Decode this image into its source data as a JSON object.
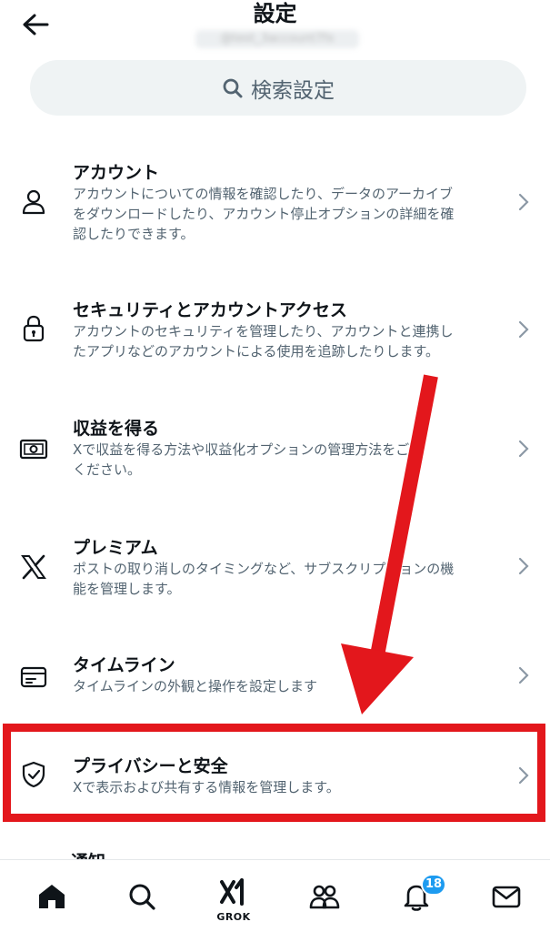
{
  "header": {
    "title": "設定",
    "account_handle": "@test_3account7fx"
  },
  "search": {
    "label": "検索設定"
  },
  "settings": [
    {
      "icon": "person-icon",
      "title": "アカウント",
      "desc": [
        "アカウントについての情報を確認したり、データのアーカイブ",
        "をダウンロードしたり、アカウント停止オプションの詳細を確",
        "認したりできます。"
      ]
    },
    {
      "icon": "lock-icon",
      "title": "セキュリティとアカウントアクセス",
      "desc": [
        "アカウントのセキュリティを管理したり、アカウントと連携し",
        "たアプリなどのアカウントによる使用を追跡したりします。"
      ]
    },
    {
      "icon": "money-icon",
      "title": "収益を得る",
      "desc": [
        "Xで収益を得る方法や収益化オプションの管理方法をご覧",
        "ください。"
      ]
    },
    {
      "icon": "x-logo-icon",
      "title": "プレミアム",
      "desc": [
        "ポストの取り消しのタイミングなど、サブスクリプションの機",
        "能を管理します。"
      ]
    },
    {
      "icon": "timeline-icon",
      "title": "タイムライン",
      "desc": [
        "タイムラインの外観と操作を設定します"
      ]
    },
    {
      "icon": "shield-icon",
      "title": "プライバシーと安全",
      "desc": [
        "Xで表示および共有する情報を管理します。"
      ]
    }
  ],
  "next_item_title": "通知",
  "bottom_nav": {
    "grok_label": "GROK",
    "notifications_badge": "18"
  },
  "colors": {
    "accent": "#1d9bf0",
    "annotation_red": "#e3171c",
    "secondary_text": "#536471"
  }
}
